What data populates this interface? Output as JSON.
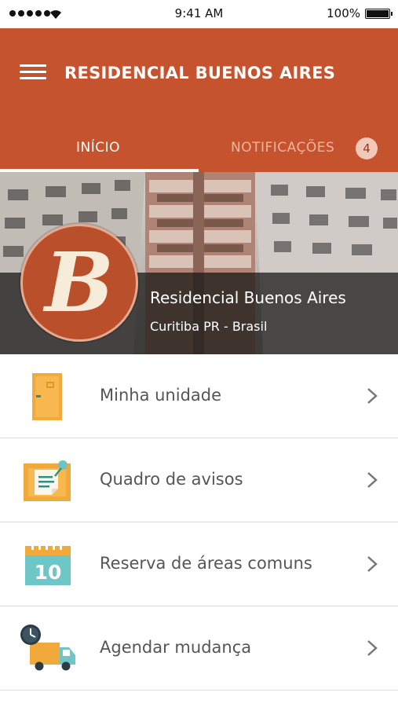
{
  "status_bar": {
    "time": "9:41 AM",
    "battery": "100%",
    "icons": [
      "signal-dots-icon",
      "wifi-icon",
      "battery-icon"
    ]
  },
  "header": {
    "title": "RESIDENCIAL BUENOS AIRES",
    "menu_icon": "hamburger-menu-icon",
    "tabs": [
      {
        "label": "INÍCIO",
        "active": true
      },
      {
        "label": "NOTIFICAÇÕES",
        "active": false,
        "badge": "4"
      }
    ],
    "color": "#c4532e"
  },
  "hero": {
    "logo_letter": "B",
    "name": "Residencial Buenos Aires",
    "location": "Curitiba PR - Brasil"
  },
  "menu": {
    "items": [
      {
        "label": "Minha unidade",
        "icon": "door-icon"
      },
      {
        "label": "Quadro de avisos",
        "icon": "notice-board-icon"
      },
      {
        "label": "Reserva de áreas comuns",
        "icon": "calendar-icon",
        "icon_text": "10"
      },
      {
        "label": "Agendar mudança",
        "icon": "moving-truck-clock-icon"
      }
    ],
    "chevron_icon": "chevron-right-icon"
  }
}
